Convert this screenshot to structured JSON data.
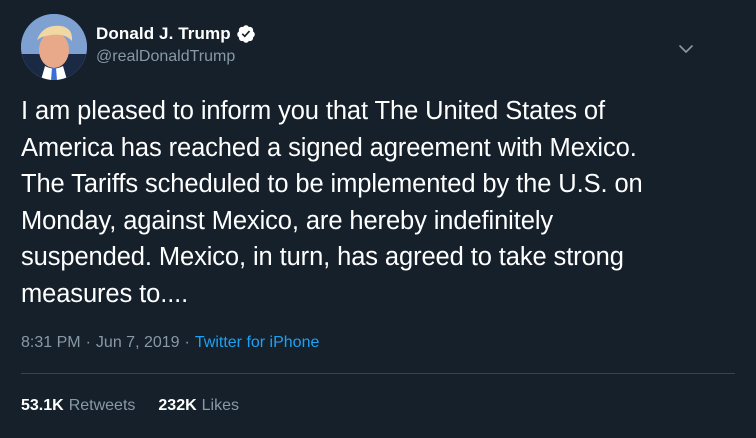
{
  "author": {
    "display_name": "Donald J. Trump",
    "handle": "@realDonaldTrump",
    "verified": true,
    "avatar": "profile-photo"
  },
  "tweet": {
    "text": "I am pleased to inform you that The United States of\nAmerica has reached a signed agreement with Mexico.\nThe Tariffs scheduled to be implemented by the U.S. on\nMonday, against Mexico, are hereby indefinitely\nsuspended. Mexico, in turn, has agreed to take strong\nmeasures to...."
  },
  "meta": {
    "time": "8:31 PM",
    "separator": "·",
    "date": "Jun 7, 2019",
    "source": "Twitter for iPhone"
  },
  "stats": {
    "retweets_count": "53.1K",
    "retweets_label": "Retweets",
    "likes_count": "232K",
    "likes_label": "Likes"
  },
  "icons": {
    "verified": "verified-badge-icon",
    "menu": "chevron-down-icon"
  },
  "colors": {
    "background": "#15202b",
    "text": "#ffffff",
    "secondary": "#8899a6",
    "link": "#1da1f2",
    "divider": "#38444d"
  }
}
